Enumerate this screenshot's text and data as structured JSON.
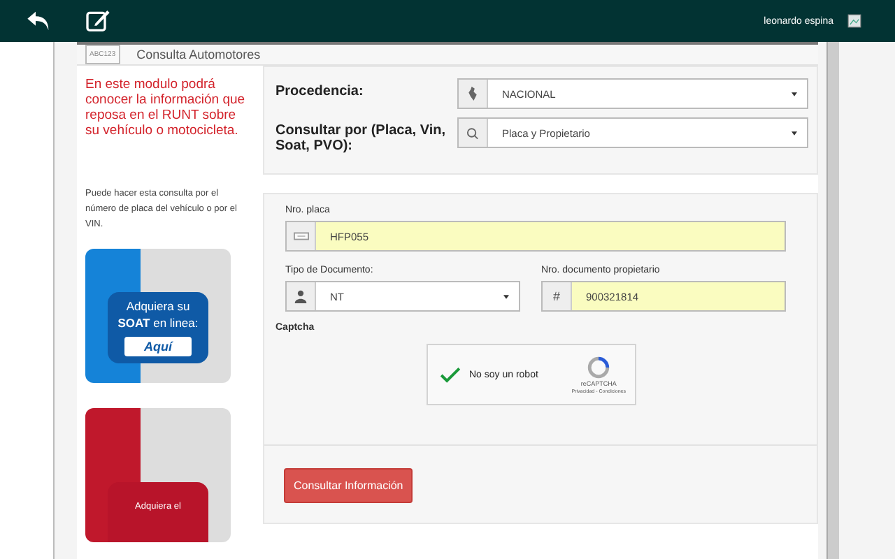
{
  "topbar": {
    "user_name": "leonardo espina"
  },
  "header": {
    "badge": "ABC123",
    "title": "Consulta Automotores"
  },
  "sidebar": {
    "intro": "En este modulo podrá conocer la información que reposa en el RUNT sobre su vehículo o motocicleta.",
    "hint": "Puede hacer esta consulta por el número de placa del vehículo o por el VIN.",
    "promos": [
      {
        "kind": "soat",
        "line_1": "Adquiera su",
        "line_2_bold": "SOAT",
        "line_2_rest": "en linea:",
        "button": "Aquí"
      },
      {
        "kind": "history",
        "line_1": "Adquiera el"
      }
    ]
  },
  "query": {
    "fields": [
      {
        "label": "Procedencia:",
        "value": "NACIONAL",
        "kind": "origin"
      },
      {
        "label": "Consultar por (Placa, Vin, Soat, PVO):",
        "value": "Placa y Propietario",
        "kind": "criteria"
      }
    ]
  },
  "form": {
    "plate": {
      "label": "Nro. placa",
      "value": "HFP055"
    },
    "doc_type": {
      "label": "Tipo de Documento:",
      "value": "NT"
    },
    "doc_number": {
      "label": "Nro. documento propietario",
      "prefix": "#",
      "value": "900321814"
    },
    "captcha": {
      "label": "Captcha",
      "text": "No soy un robot",
      "checked": true,
      "brand": "reCAPTCHA",
      "links": "Privacidad - Condiciones"
    },
    "submit": "Consultar Información"
  }
}
